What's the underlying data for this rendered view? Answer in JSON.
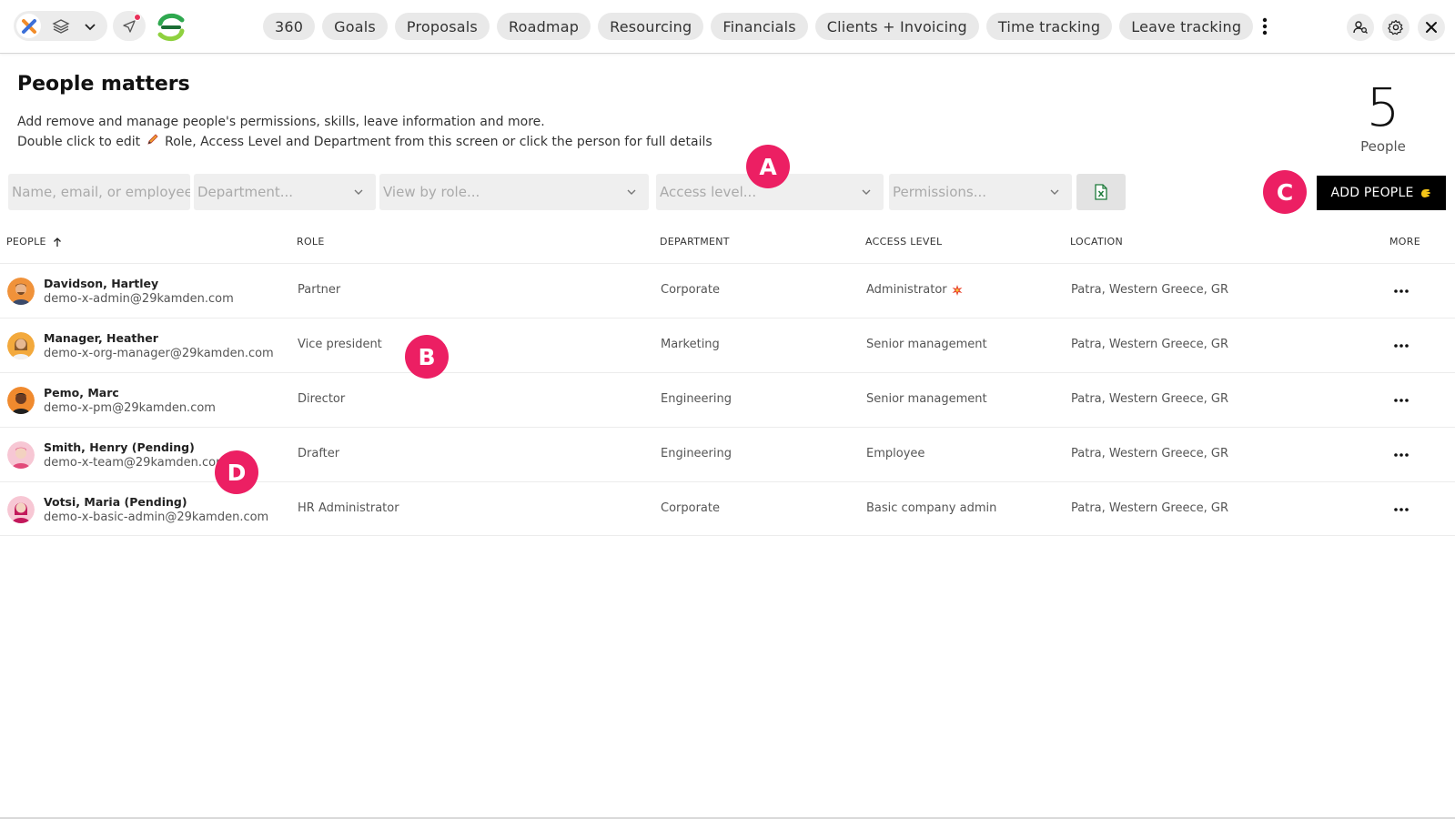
{
  "topbar": {
    "nav": [
      "360",
      "Goals",
      "Proposals",
      "Roadmap",
      "Resourcing",
      "Financials",
      "Clients + Invoicing",
      "Time tracking",
      "Leave tracking"
    ],
    "icons": {
      "app_switch": "x-logo-icon",
      "layers": "layers-icon",
      "dropdown": "chevron-down-icon",
      "send": "send-icon",
      "brand_logo": "brand-logo-icon",
      "more": "more-vertical-icon",
      "people_search": "people-search-icon",
      "settings": "gear-icon",
      "close": "close-icon"
    }
  },
  "header": {
    "title": "People matters",
    "description_line1": "Add remove and manage people's permissions, skills, leave information and more.",
    "description_line2_before": "Double click to edit",
    "description_line2_after": "Role, Access Level and Department from this screen or click the person for full details",
    "count": "5",
    "count_label": "People"
  },
  "filters": {
    "search_placeholder": "Name, email, or employee ID",
    "department_placeholder": "Department...",
    "role_placeholder": "View by role...",
    "access_placeholder": "Access level...",
    "permissions_placeholder": "Permissions...",
    "export_icon": "excel-icon",
    "add_button": "ADD PEOPLE"
  },
  "table": {
    "columns": [
      "PEOPLE",
      "ROLE",
      "DEPARTMENT",
      "ACCESS LEVEL",
      "LOCATION",
      "MORE"
    ],
    "rows": [
      {
        "name": "Davidson, Hartley",
        "email": "demo-x-admin@29kamden.com",
        "role": "Partner",
        "department": "Corporate",
        "access": "Administrator",
        "location": "Patra, Western Greece, GR"
      },
      {
        "name": "Manager, Heather",
        "email": "demo-x-org-manager@29kamden.com",
        "role": "Vice president",
        "department": "Marketing",
        "access": "Senior management",
        "location": "Patra, Western Greece, GR"
      },
      {
        "name": "Pemo, Marc",
        "email": "demo-x-pm@29kamden.com",
        "role": "Director",
        "department": "Engineering",
        "access": "Senior management",
        "location": "Patra, Western Greece, GR"
      },
      {
        "name": "Smith, Henry (Pending)",
        "email": "demo-x-team@29kamden.com",
        "role": "Drafter",
        "department": "Engineering",
        "access": "Employee",
        "location": "Patra, Western Greece, GR"
      },
      {
        "name": "Votsi, Maria (Pending)",
        "email": "demo-x-basic-admin@29kamden.com",
        "role": "HR Administrator",
        "department": "Corporate",
        "access": "Basic company admin",
        "location": "Patra, Western Greece, GR"
      }
    ]
  },
  "annotations": {
    "a": "A",
    "b": "B",
    "c": "C",
    "d": "D"
  },
  "colors": {
    "marker": "#ec1f63",
    "add_button_bg": "#000000",
    "excel_green": "#1d7a3a"
  }
}
